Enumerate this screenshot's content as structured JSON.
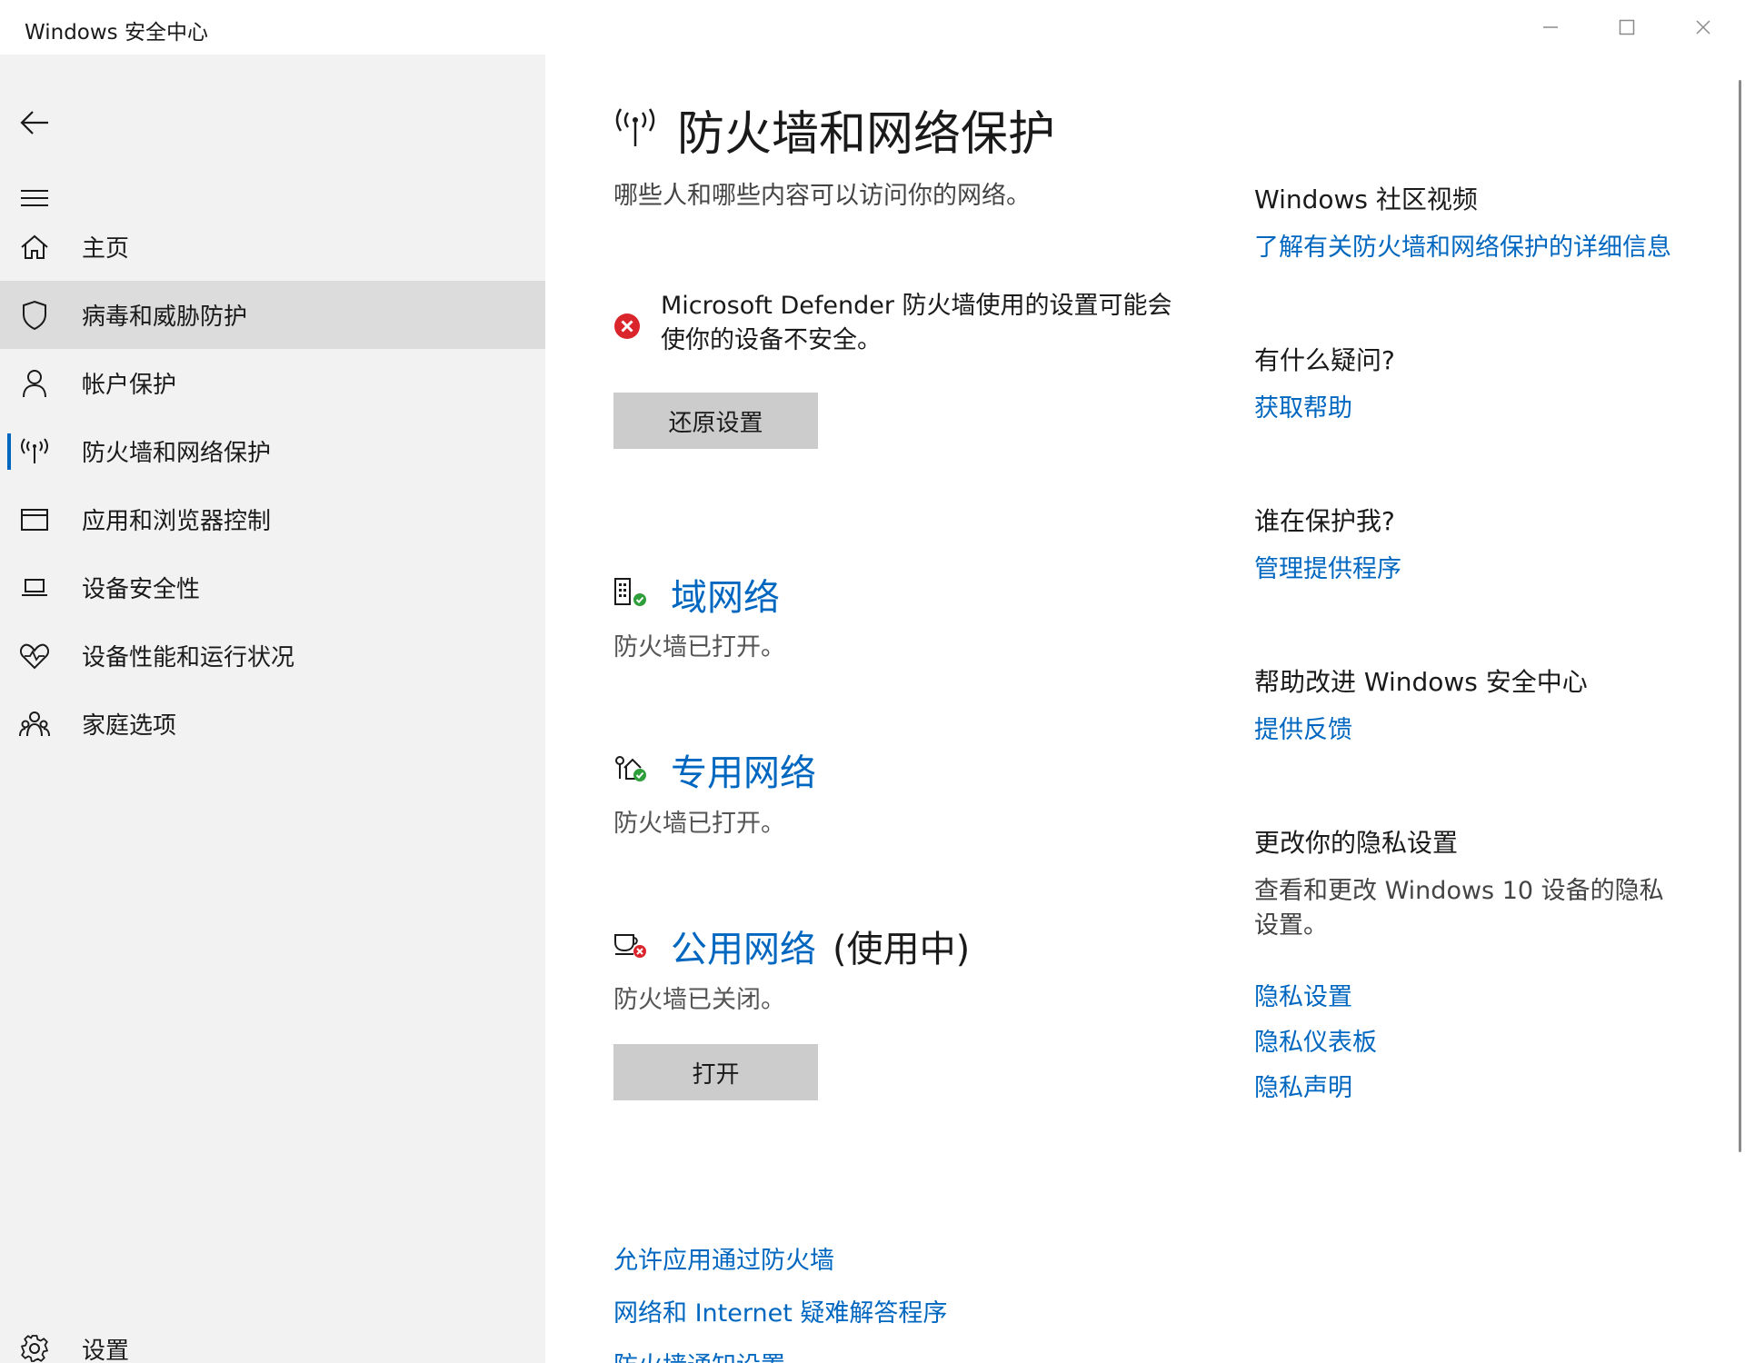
{
  "window": {
    "title": "Windows 安全中心"
  },
  "sidebar": {
    "items": [
      {
        "label": "主页",
        "icon": "home-icon"
      },
      {
        "label": "病毒和威胁防护",
        "icon": "shield-icon"
      },
      {
        "label": "帐户保护",
        "icon": "person-icon"
      },
      {
        "label": "防火墙和网络保护",
        "icon": "antenna-icon"
      },
      {
        "label": "应用和浏览器控制",
        "icon": "browser-window-icon"
      },
      {
        "label": "设备安全性",
        "icon": "laptop-icon"
      },
      {
        "label": "设备性能和运行状况",
        "icon": "heart-pulse-icon"
      },
      {
        "label": "家庭选项",
        "icon": "family-icon"
      }
    ],
    "settings_label": "设置"
  },
  "main": {
    "title": "防火墙和网络保护",
    "subtitle": "哪些人和哪些内容可以访问你的网络。",
    "warning": {
      "text": "Microsoft Defender 防火墙使用的设置可能会使你的设备不安全。",
      "button": "还原设置"
    },
    "networks": [
      {
        "name": "域网络",
        "suffix": "",
        "status": "防火墙已打开。",
        "state_color": "#2e9f3a"
      },
      {
        "name": "专用网络",
        "suffix": "",
        "status": "防火墙已打开。",
        "state_color": "#2e9f3a"
      },
      {
        "name": "公用网络",
        "suffix": "(使用中)",
        "status": "防火墙已关闭。",
        "state_color": "#d9252b",
        "button": "打开"
      }
    ],
    "bottom_links": [
      "允许应用通过防火墙",
      "网络和 Internet 疑难解答程序",
      "防火墙通知设置"
    ]
  },
  "right": {
    "sections": [
      {
        "heading": "Windows 社区视频",
        "links": [
          "了解有关防火墙和网络保护的详细信息"
        ]
      },
      {
        "heading": "有什么疑问?",
        "links": [
          "获取帮助"
        ]
      },
      {
        "heading": "谁在保护我?",
        "links": [
          "管理提供程序"
        ]
      },
      {
        "heading": "帮助改进 Windows 安全中心",
        "links": [
          "提供反馈"
        ]
      },
      {
        "heading": "更改你的隐私设置",
        "text": "查看和更改 Windows 10 设备的隐私设置。",
        "links": [
          "隐私设置",
          "隐私仪表板",
          "隐私声明"
        ]
      }
    ]
  },
  "colors": {
    "accent": "#0067c0",
    "error": "#d9252b",
    "success": "#2e9f3a",
    "sidebar_bg": "#f2f2f2"
  }
}
